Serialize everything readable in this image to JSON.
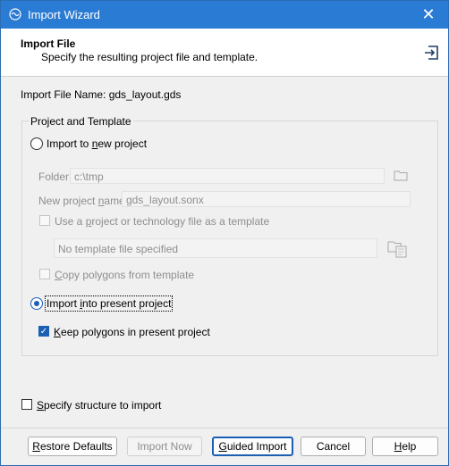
{
  "window": {
    "title": "Import Wizard",
    "close_glyph": "✕"
  },
  "header": {
    "title": "Import File",
    "subtitle": "Specify the resulting project file and template.",
    "icon": "import-icon"
  },
  "import_file": {
    "label": "Import File Name: gds_layout.gds"
  },
  "group": {
    "legend": "Project and Template"
  },
  "new_project": {
    "radio_pre": "Import to ",
    "radio_u": "n",
    "radio_post": "ew project",
    "folder_label": "Folder",
    "folder_value": "c:\\tmp",
    "name_label_pre": "New project ",
    "name_label_u": "n",
    "name_label_post": "ame",
    "name_value": "gds_layout.sonx",
    "template_chk_pre": "Use a ",
    "template_chk_u": "p",
    "template_chk_post": "roject or technology file as a template",
    "template_file": "No template file specified",
    "copy_chk_u": "C",
    "copy_chk_post": "opy polygons from template"
  },
  "present_project": {
    "radio_pre": "Import ",
    "radio_u": "i",
    "radio_post": "nto present project",
    "keep_chk_u": "K",
    "keep_chk_post": "eep polygons in present project"
  },
  "structure": {
    "chk_u": "S",
    "chk_post": "pecify structure to import"
  },
  "buttons": {
    "restore_u": "R",
    "restore_post": "estore Defaults",
    "import_now": "Import Now",
    "guided_u": "G",
    "guided_post": "uided Import",
    "cancel": "Cancel",
    "help_u": "H",
    "help_post": "elp"
  },
  "colors": {
    "titlebar": "#2a7bd4",
    "accent": "#1a5fb4"
  }
}
